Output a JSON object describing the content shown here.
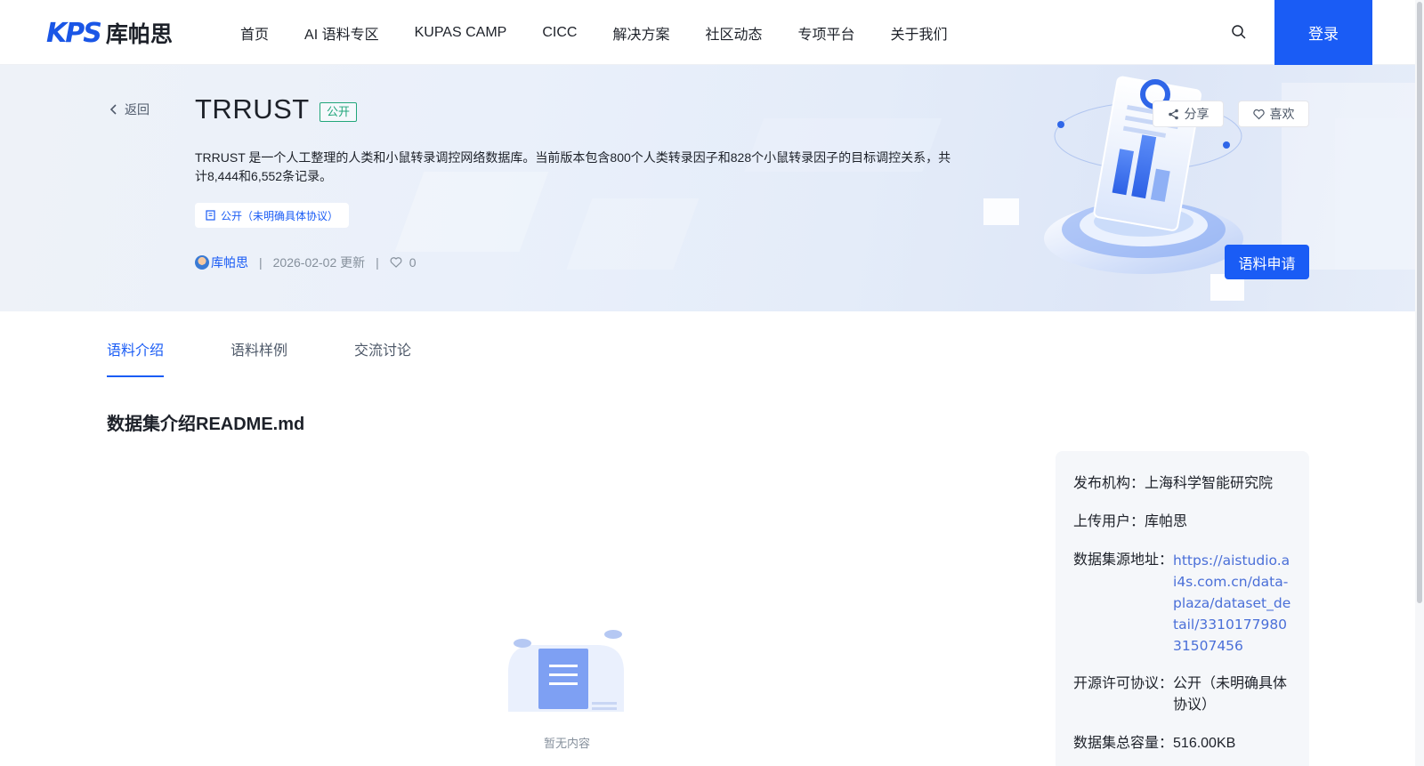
{
  "header": {
    "logo_mark": "KPS",
    "logo_text": "库帕思",
    "nav": [
      "首页",
      "AI 语料专区",
      "KUPAS CAMP",
      "CICC",
      "解决方案",
      "社区动态",
      "专项平台",
      "关于我们"
    ],
    "login_label": "登录"
  },
  "banner": {
    "back_label": "返回",
    "title": "TRRUST",
    "visibility_tag": "公开",
    "description": "TRRUST 是一个人工整理的人类和小鼠转录调控网络数据库。当前版本包含800个人类转录因子和828个小鼠转录因子的目标调控关系，共计8,444和6,552条记录。",
    "license_chip": "公开（未明确具体协议）",
    "author": "库帕思",
    "updated": "2026-02-02 更新",
    "likes": "0",
    "share_label": "分享",
    "like_label": "喜欢",
    "apply_label": "语料申请"
  },
  "tabs": [
    {
      "label": "语料介绍",
      "active": true
    },
    {
      "label": "语料样例",
      "active": false
    },
    {
      "label": "交流讨论",
      "active": false
    }
  ],
  "content": {
    "section_title": "数据集介绍README.md",
    "empty_text": "暂无内容"
  },
  "info": {
    "org_key": "发布机构：",
    "org_val": "上海科学智能研究院",
    "uploader_key": "上传用户：",
    "uploader_val": "库帕思",
    "source_key": "数据集源地址：",
    "source_val": "https://aistudio.ai4s.com.cn/data-plaza/dataset_detail/331017798031507456",
    "license_key": "开源许可协议：",
    "license_val": "公开（未明确具体协议）",
    "size_key": "数据集总容量：",
    "size_val": "516.00KB"
  },
  "colors": {
    "primary": "#1a5cf5",
    "public_green": "#21a67a"
  },
  "icons": [
    "search-icon",
    "chevron-left-icon",
    "book-icon",
    "heart-icon",
    "share-icon",
    "document-icon"
  ]
}
